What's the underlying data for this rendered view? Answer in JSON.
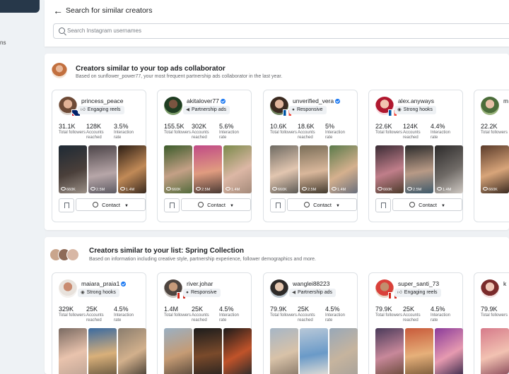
{
  "sidebar": {
    "fragment": "ns"
  },
  "header": {
    "title": "Search for similar creators",
    "search_placeholder": "Search Instagram usernames"
  },
  "colors": {
    "accent": "#1877f2",
    "text": "#1c1e21",
    "muted": "#65676b"
  },
  "sections": [
    {
      "title": "Creators similar to your top ads collaborator",
      "subtitle": "Based on sunflower_power77, your most frequent partnership ads collaborator in the last year.",
      "cards": [
        {
          "handle": "princess_peace",
          "verified": false,
          "flag": "uk",
          "tag": "Engaging reels",
          "tag_icon": "thumbs-up-icon",
          "stats": [
            {
              "value": "31.1K",
              "label": "Total followers"
            },
            {
              "value": "128K",
              "label": "Accounts reached"
            },
            {
              "value": "3.5%",
              "label": "Interaction rate"
            }
          ],
          "thumbs": [
            "660K",
            "2.5M",
            "1.4M"
          ],
          "contact": "Contact"
        },
        {
          "handle": "akitalover77",
          "verified": true,
          "flag": "",
          "tag": "Partnership ads",
          "tag_icon": "megaphone-icon",
          "stats": [
            {
              "value": "155.5K",
              "label": "Total followers"
            },
            {
              "value": "302K",
              "label": "Accounts reached"
            },
            {
              "value": "5.6%",
              "label": "Interaction rate"
            }
          ],
          "thumbs": [
            "660K",
            "2.5M",
            "1.4M"
          ],
          "contact": "Contact"
        },
        {
          "handle": "unverified_vera",
          "verified": true,
          "flag": "fr",
          "tag": "Responsive",
          "tag_icon": "chat-bubble-icon",
          "stats": [
            {
              "value": "10.6K",
              "label": "Total followers"
            },
            {
              "value": "18.6K",
              "label": "Accounts reached"
            },
            {
              "value": "5%",
              "label": "Interaction rate"
            }
          ],
          "thumbs": [
            "660K",
            "2.5M",
            "1.4M"
          ],
          "contact": "Contact"
        },
        {
          "handle": "alex.anyways",
          "verified": false,
          "flag": "fr",
          "tag": "Strong hooks",
          "tag_icon": "eye-icon",
          "stats": [
            {
              "value": "22.6K",
              "label": "Total followers"
            },
            {
              "value": "124K",
              "label": "Accounts reached"
            },
            {
              "value": "4.4%",
              "label": "Interaction rate"
            }
          ],
          "thumbs": [
            "660K",
            "2.5M",
            "1.4M"
          ],
          "contact": "Contact"
        },
        {
          "handle": "m",
          "verified": false,
          "flag": "",
          "tag": "",
          "tag_icon": "",
          "stats": [
            {
              "value": "22.2K",
              "label": "Total followers"
            }
          ],
          "thumbs": [
            "660K"
          ],
          "contact": ""
        }
      ]
    },
    {
      "title": "Creators similar to your list: Spring Collection",
      "subtitle": "Based on information including creative style, partnership experience, follower demographics and more.",
      "cards": [
        {
          "handle": "maiara_praia1",
          "verified": true,
          "flag": "",
          "tag": "Strong hooks",
          "tag_icon": "eye-icon",
          "stats": [
            {
              "value": "329K",
              "label": "Total followers"
            },
            {
              "value": "25K",
              "label": "Accounts reached"
            },
            {
              "value": "4.5%",
              "label": "Interaction rate"
            }
          ],
          "thumbs": [
            "",
            "",
            ""
          ]
        },
        {
          "handle": "river.johar",
          "verified": false,
          "flag": "ca",
          "tag": "Responsive",
          "tag_icon": "chat-bubble-icon",
          "stats": [
            {
              "value": "1.4M",
              "label": "Total followers"
            },
            {
              "value": "25K",
              "label": "Accounts reached"
            },
            {
              "value": "4.5%",
              "label": "Interaction rate"
            }
          ],
          "thumbs": [
            "",
            "",
            ""
          ]
        },
        {
          "handle": "wanglei88223",
          "verified": false,
          "flag": "",
          "tag": "Partnership ads",
          "tag_icon": "megaphone-icon",
          "stats": [
            {
              "value": "79.9K",
              "label": "Total followers"
            },
            {
              "value": "25K",
              "label": "Accounts reached"
            },
            {
              "value": "4.5%",
              "label": "Interaction rate"
            }
          ],
          "thumbs": [
            "",
            "",
            ""
          ]
        },
        {
          "handle": "super_santi_73",
          "verified": false,
          "flag": "ca",
          "tag": "Engaging reels",
          "tag_icon": "thumbs-up-icon",
          "stats": [
            {
              "value": "79.9K",
              "label": "Total followers"
            },
            {
              "value": "25K",
              "label": "Accounts reached"
            },
            {
              "value": "4.5%",
              "label": "Interaction rate"
            }
          ],
          "thumbs": [
            "",
            "",
            ""
          ]
        },
        {
          "handle": "k",
          "verified": false,
          "flag": "",
          "tag": "",
          "tag_icon": "",
          "stats": [
            {
              "value": "79.9K",
              "label": "Total followers"
            }
          ],
          "thumbs": [
            ""
          ]
        }
      ]
    }
  ]
}
